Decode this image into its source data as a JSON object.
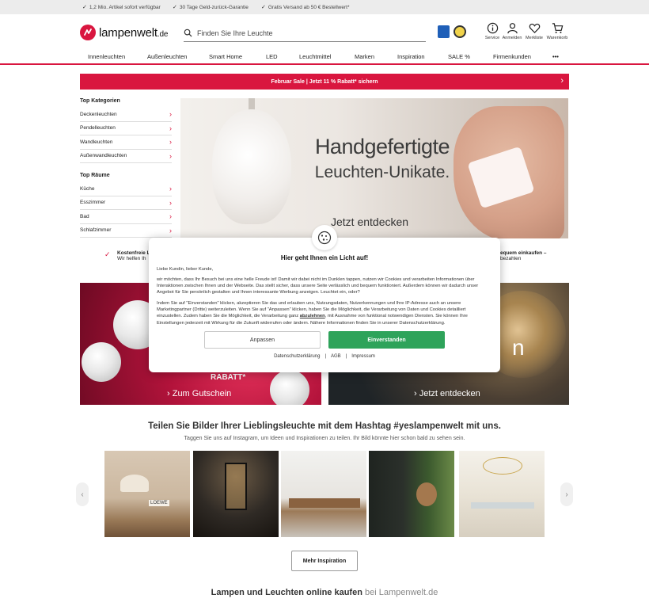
{
  "topbar": {
    "usps": [
      "1,2 Mio. Artikel sofort verfügbar",
      "30 Tage Geld-zurück-Garantie",
      "Gratis Versand ab 50 € Bestellwert*"
    ]
  },
  "header": {
    "logo_text": "lampenwelt",
    "logo_tld": ".de",
    "search_placeholder": "Finden Sie Ihre Leuchte",
    "icons": [
      {
        "label": "Service",
        "icon": "info-icon"
      },
      {
        "label": "Anmelden",
        "icon": "user-icon"
      },
      {
        "label": "Merkliste",
        "icon": "heart-icon"
      },
      {
        "label": "Warenkorb",
        "icon": "cart-icon"
      }
    ]
  },
  "nav": [
    "Innenleuchten",
    "Außenleuchten",
    "Smart Home",
    "LED",
    "Leuchtmittel",
    "Marken",
    "Inspiration",
    "SALE %",
    "Firmenkunden",
    "•••"
  ],
  "sale_banner": "Februar Sale | Jetzt 11 % Rabatt* sichern",
  "sidebar": {
    "categories_title": "Top Kategorien",
    "categories": [
      "Deckenleuchten",
      "Pendelleuchten",
      "Wandleuchten",
      "Außenwandleuchten"
    ],
    "rooms_title": "Top Räume",
    "rooms": [
      "Küche",
      "Esszimmer",
      "Bad",
      "Schlafzimmer"
    ]
  },
  "hero": {
    "headline": "Handgefertigte",
    "subline": "Leuchten-Unikate.",
    "cta": "Jetzt entdecken"
  },
  "usp_strip": {
    "left_title": "Kostenfreie L",
    "left_text": "Wir helfen Ih",
    "right_title": "equem einkaufen –",
    "right_text": "bezahlen"
  },
  "tiles": {
    "left_tag": "RABATT*",
    "left_cta": "› Zum Gutschein",
    "right_cta": "› Jetzt entdecken",
    "right_fragment": "n"
  },
  "cookie": {
    "title": "Hier geht Ihnen ein Licht auf!",
    "greeting": "Liebe Kundin, lieber Kunde,",
    "para1": "wir möchten, dass Ihr Besuch bei uns eine helle Freude ist! Damit wir dabei nicht im Dunklen tappen, nutzen wir Cookies und verarbeiten Informationen über Interaktionen zwischen Ihnen und der Webseite. Das stellt sicher, dass unsere Seite verlässlich und bequem funktioniert. Außerdem können wir dadurch unser Angebot für Sie persönlich gestalten und Ihnen interessante Werbung anzeigen. Leuchtet ein, oder?",
    "para2_a": "Indem Sie auf \"Einverstanden\" klicken, akzeptieren Sie das und erlauben uns, Nutzungsdaten, Nutzerkennungen und Ihre IP-Adresse auch an unsere Marketingpartner (Dritte) weiterzuleiten. Wenn Sie auf \"Anpassen\" klicken, haben Sie die Möglichkeit, die Verarbeitung von Daten und Cookies detailliert einzustellen. Zudem haben Sie die Möglichkeit, die Verarbeitung ganz ",
    "para2_link": "abzulehnen",
    "para2_b": ", mit Ausnahme von funktional notwendigen Diensten. Sie können Ihre Einstellungen jederzeit mit Wirkung für die Zukunft widerrufen oder ändern. Nähere Informationen finden Sie in unserer Datenschutzerklärung.",
    "btn_adjust": "Anpassen",
    "btn_accept": "Einverstanden",
    "links": [
      "Datenschutzerklärung",
      "AGB",
      "Impressum"
    ]
  },
  "instagram": {
    "title": "Teilen Sie Bilder Ihrer Lieblingsleuchte mit dem Hashtag #yeslampenwelt mit uns.",
    "subtitle": "Taggen Sie uns auf Instagram, um Ideen und Inspirationen zu teilen. Ihr Bild könnte hier schon bald zu sehen sein.",
    "photo_tag": "LOEWE",
    "more_button": "Mehr Inspiration"
  },
  "footer": {
    "title_bold": "Lampen und Leuchten online kaufen",
    "title_light": " bei Lampenwelt.de"
  },
  "colors": {
    "brand_red": "#d9163f",
    "accept_green": "#2ea35a"
  }
}
